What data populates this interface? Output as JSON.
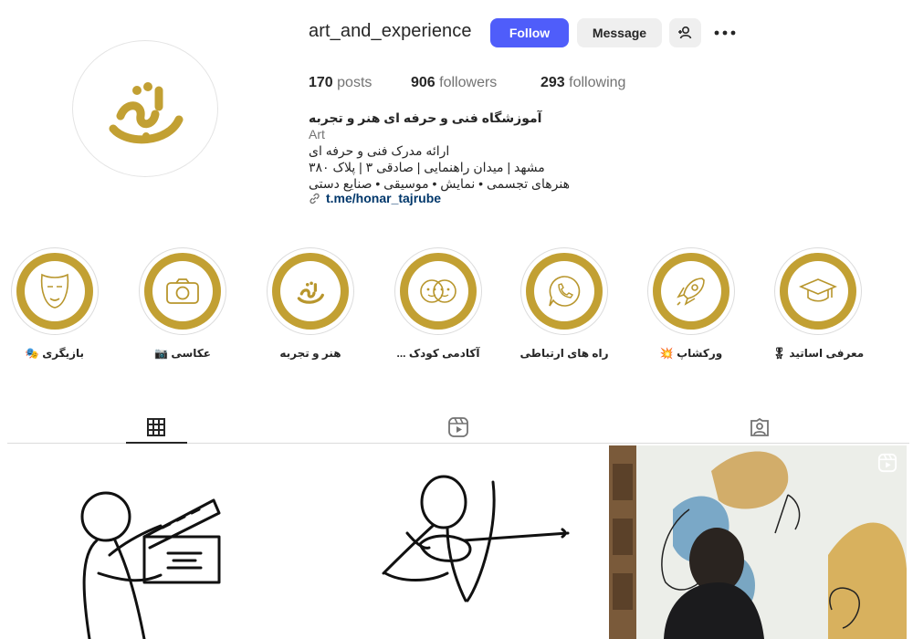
{
  "profile": {
    "username": "art_and_experience",
    "follow_label": "Follow",
    "message_label": "Message",
    "stats": {
      "posts_count": "170",
      "posts_label": "posts",
      "followers_count": "906",
      "followers_label": "followers",
      "following_count": "293",
      "following_label": "following"
    },
    "bio": {
      "name": "آموزشگاه فنی و حرفه ای هنر و تجربه",
      "category": "Art",
      "lines": [
        "ارائه مدرک فنی و حرفه ای",
        "مشهد | میدان راهنمایی | صادقی ۳ | پلاک ۳۸۰",
        "هنرهای تجسمی • نمایش • موسیقی • صنایع دستی"
      ],
      "link": "t.me/honar_tajrube"
    }
  },
  "highlights": [
    {
      "label": "بازیگری 🎭",
      "icon": "mask-icon"
    },
    {
      "label": "عکاسی 📷",
      "icon": "camera-icon"
    },
    {
      "label": "هنر و تجربه",
      "icon": "logo-icon"
    },
    {
      "label": "آکادمی کودک ...",
      "icon": "kids-icon"
    },
    {
      "label": "راه های ارتباطی",
      "icon": "phone-icon"
    },
    {
      "label": "ورکشاپ 💥",
      "icon": "rocket-icon"
    },
    {
      "label": "معرفی اساتید 🎖",
      "icon": "graduation-cap-icon"
    }
  ],
  "tabs": [
    {
      "name": "posts",
      "icon": "grid-icon",
      "active": true
    },
    {
      "name": "reels",
      "icon": "reels-icon",
      "active": false
    },
    {
      "name": "tagged",
      "icon": "tagged-icon",
      "active": false
    }
  ],
  "colors": {
    "accent": "#4f5dfa",
    "highlight_gold": "#c2a033",
    "link": "#00376b"
  }
}
